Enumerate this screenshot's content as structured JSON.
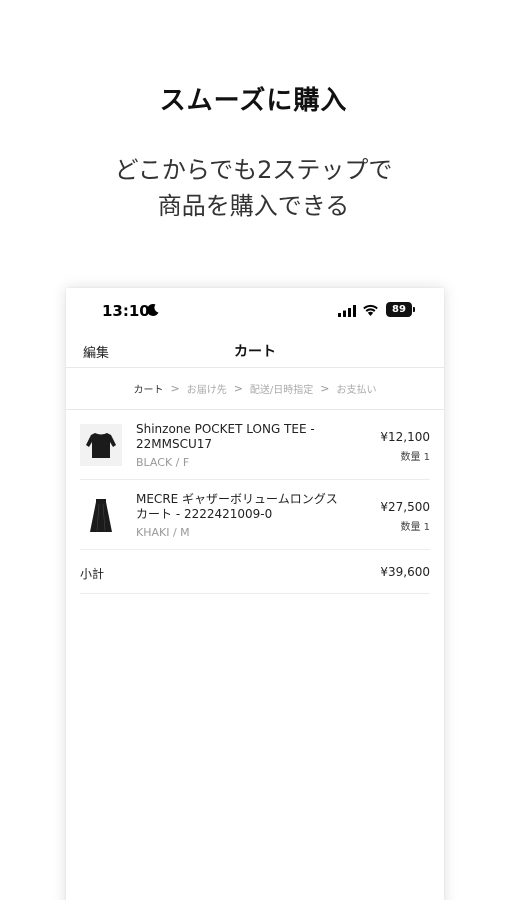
{
  "promo": {
    "title": "スムーズに購入",
    "subtitle_line1": "どこからでも2ステップで",
    "subtitle_line2": "商品を購入できる"
  },
  "status_bar": {
    "time": "13:10",
    "battery": "89"
  },
  "nav": {
    "edit_label": "編集",
    "title": "カート"
  },
  "steps": [
    {
      "label": "カート",
      "active": true
    },
    {
      "label": "お届け先",
      "active": false
    },
    {
      "label": "配送/日時指定",
      "active": false
    },
    {
      "label": "お支払い",
      "active": false
    }
  ],
  "step_separator": ">",
  "cart_items": [
    {
      "name": "Shinzone POCKET LONG TEE - 22MMSCU17",
      "variant": "BLACK / F",
      "price": "¥12,100",
      "quantity": "数量 1",
      "thumb_icon": "black-shirt-icon"
    },
    {
      "name": "MECRE ギャザーボリュームロングスカート - 2222421009-0",
      "variant": "KHAKI / M",
      "price": "¥27,500",
      "quantity": "数量 1",
      "thumb_icon": "black-skirt-icon"
    }
  ],
  "subtotal": {
    "label": "小計",
    "value": "¥39,600"
  },
  "colors": {
    "accent": "#111111",
    "muted_text": "#999999",
    "divider": "#e8e8e8"
  }
}
